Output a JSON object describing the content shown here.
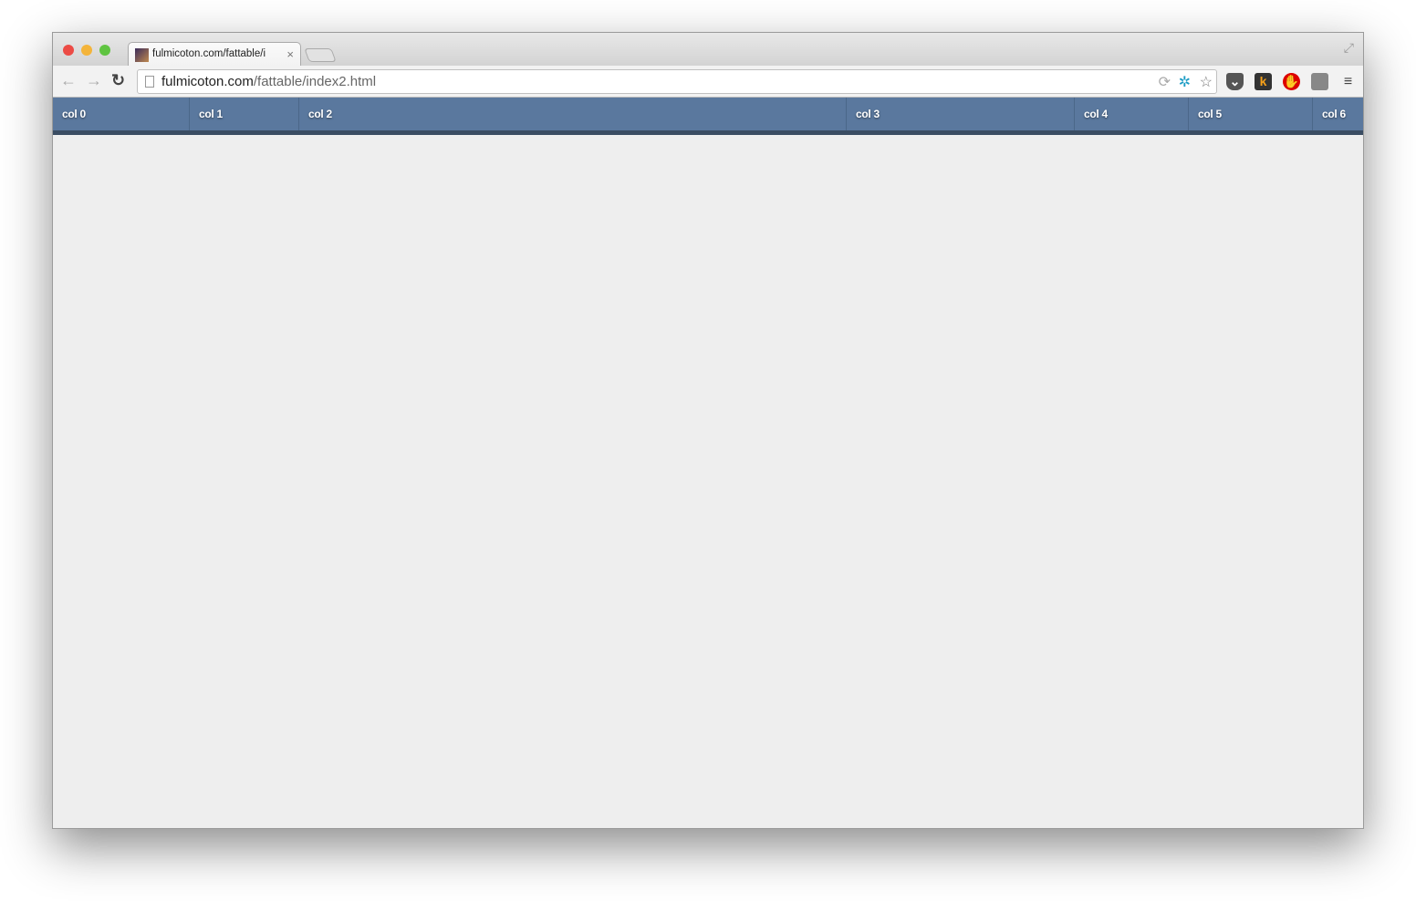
{
  "browser": {
    "tab_title": "fulmicoton.com/fattable/i",
    "url_host": "fulmicoton.com",
    "url_path": "/fattable/index2.html",
    "close_tab": "×",
    "extensions": [
      "pocket-icon",
      "k-icon",
      "adblock-icon",
      "ghostery-icon",
      "menu-icon"
    ]
  },
  "table": {
    "columns": [
      "col 0",
      "col 1",
      "col 2",
      "col 3",
      "col 4",
      "col 5",
      "col 6"
    ],
    "header_color": "#5a789e"
  }
}
